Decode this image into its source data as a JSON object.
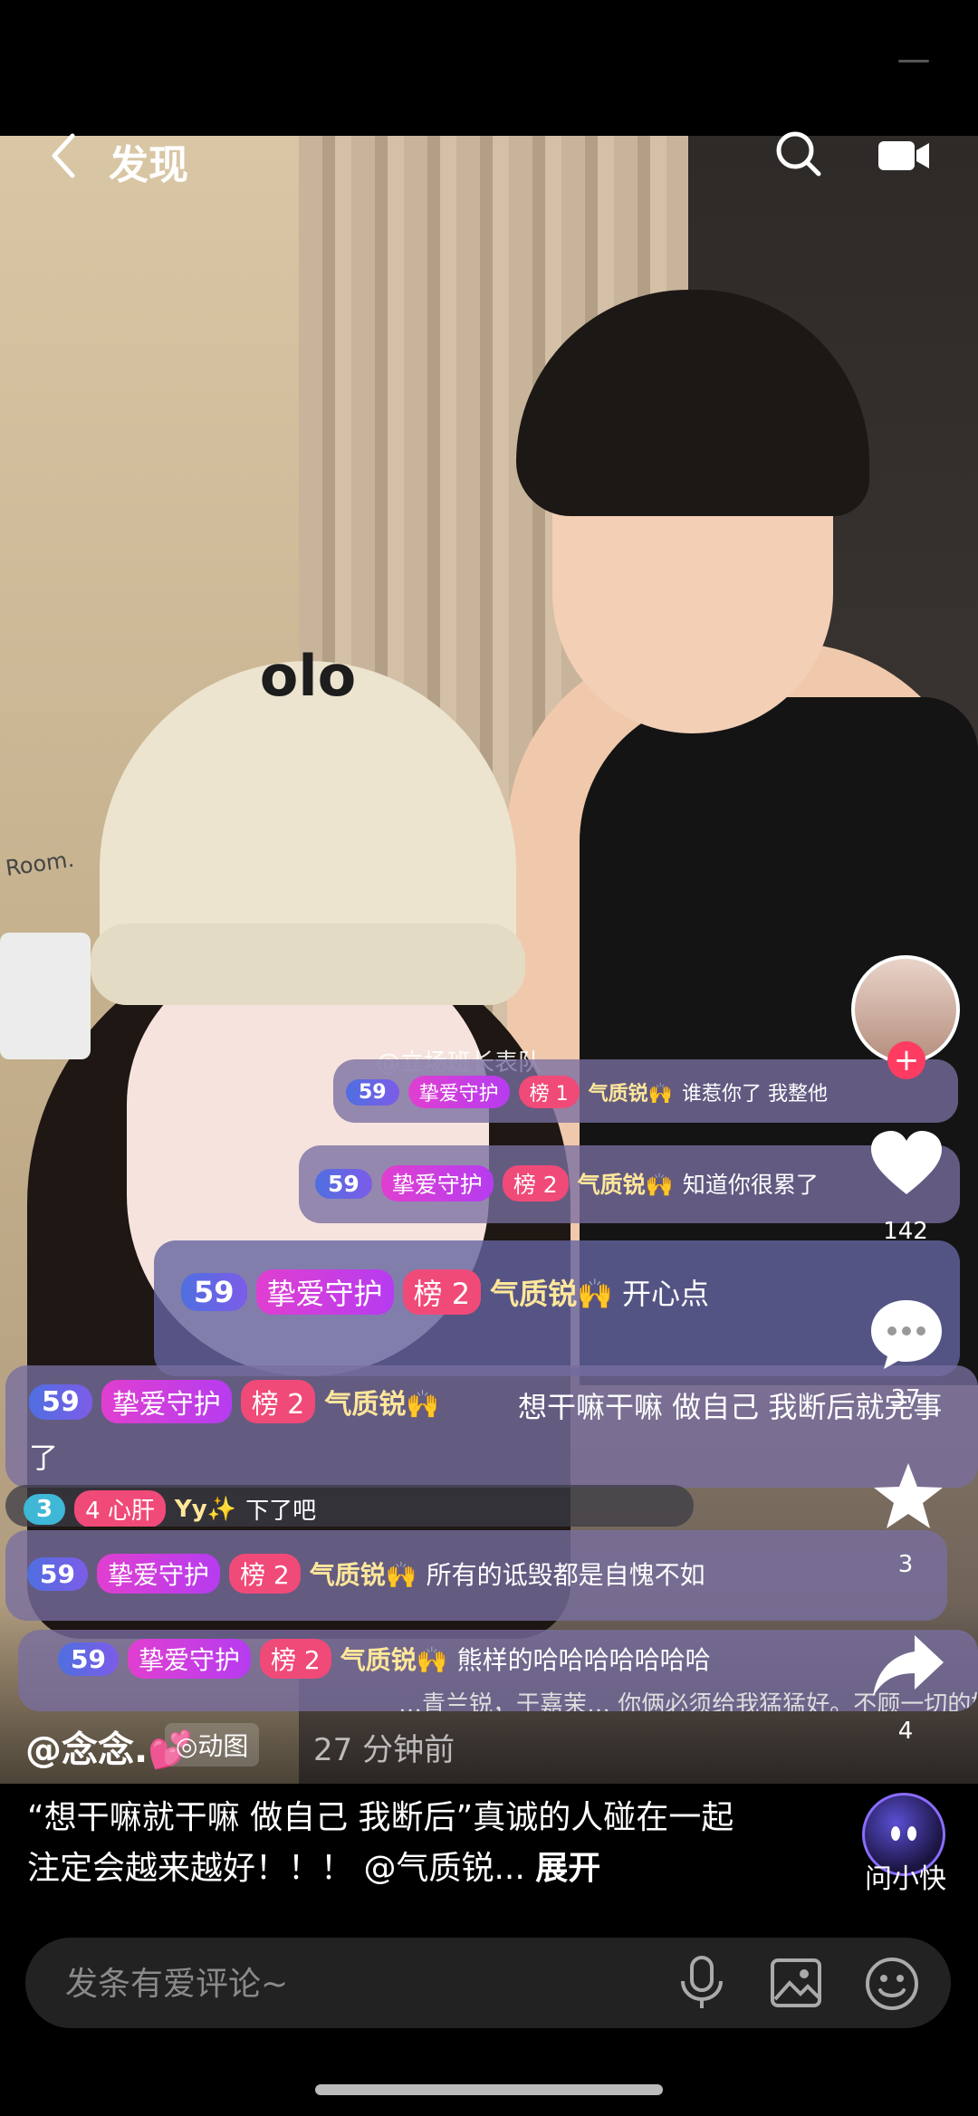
{
  "header": {
    "title": "发现"
  },
  "watermark": "@立场班长表队",
  "comments": [
    {
      "level": "59",
      "guard": "挚爱守护",
      "rank": "榜 1",
      "user": "气质锐🙌",
      "text": "谁惹你了 我整他"
    },
    {
      "level": "59",
      "guard": "挚爱守护",
      "rank": "榜 2",
      "user": "气质锐🙌",
      "text": "知道你很累了"
    },
    {
      "level": "59",
      "guard": "挚爱守护",
      "rank": "榜 2",
      "user": "气质锐🙌",
      "text": "开心点"
    },
    {
      "level": "59",
      "guard": "挚爱守护",
      "rank": "榜 2",
      "user": "气质锐🙌",
      "text": "想干嘛干嘛 做自己 我断后就完事了"
    },
    {
      "level": "3",
      "guard": "4 心肝",
      "rank": "",
      "user": "Yy✨",
      "text": "下了吧"
    },
    {
      "level": "59",
      "guard": "挚爱守护",
      "rank": "榜 2",
      "user": "气质锐🙌",
      "text": "所有的诋毁都是自愧不如"
    },
    {
      "level": "59",
      "guard": "挚爱守护",
      "rank": "榜 2",
      "user": "气质锐🙌",
      "text": "熊样的哈哈哈哈哈哈哈"
    }
  ],
  "overlay_tail": "…青兰锐，于嘉茉… 你俩必须给我猛猛好。不顾一切的好",
  "room_label": "Room.",
  "cap_logo": "olo",
  "rail": {
    "follow": "+",
    "likes": "142",
    "comments": "37",
    "favorites": "3",
    "shares": "4"
  },
  "author": {
    "name": "@念念.💕",
    "badge": "◎动图",
    "time": "27 分钟前"
  },
  "caption": {
    "text": "“想干嘛就干嘛 做自己 我断后”真诚的人碰在一起 注定会越来越好！！！ @气质锐... ",
    "expand": "展开"
  },
  "assistant": {
    "label": "问小快"
  },
  "comment_box": {
    "placeholder": "发条有爱评论~"
  }
}
